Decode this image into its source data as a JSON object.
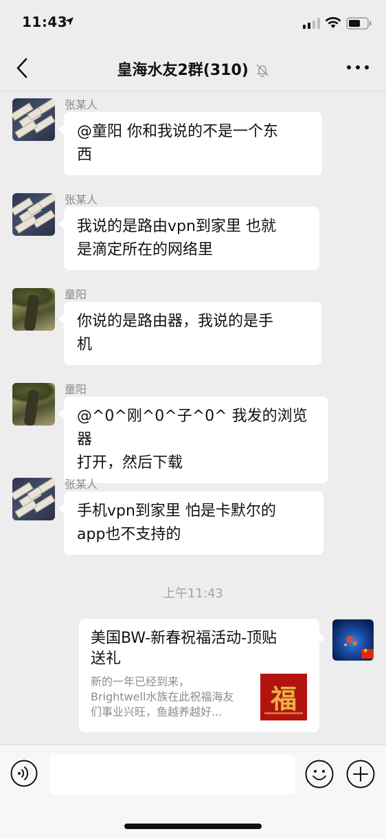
{
  "status_bar": {
    "time": "11:43"
  },
  "nav": {
    "title": "皇海水友2群(310)"
  },
  "messages": [
    {
      "sender": "张某人",
      "text": "@童阳 你和我说的不是一个东西",
      "line1": "@童阳 你和我说的不是一个东",
      "line2": "西"
    },
    {
      "sender": "张某人",
      "text": "我说的是路由vpn到家里 也就是滴定所在的网络里",
      "line1": "我说的是路由vpn到家里 也就",
      "line2": "是滴定所在的网络里"
    },
    {
      "sender": "童阳",
      "text": "你说的是路由器，我说的是手机",
      "line1": "你说的是路由器，我说的是手",
      "line2": "机"
    },
    {
      "sender": "童阳",
      "text": "@^0^刚^0^子^0^ 我发的浏览器打开，然后下载",
      "line1": "@^0^刚^0^子^0^ 我发的浏览器",
      "line2": "打开，然后下载"
    },
    {
      "sender": "张某人",
      "text": "手机vpn到家里  怕是卡默尔的app也不支持的",
      "line1": "手机vpn到家里  怕是卡默尔的",
      "line2": "app也不支持的"
    }
  ],
  "timestamp": "上午11:43",
  "link_card": {
    "title_line1": "美国BW-新春祝福活动-顶贴",
    "title_line2": "送礼",
    "desc": "新的一年已经到来，Brightwell水族在此祝福海友们事业兴旺，鱼越养越好…",
    "desc_line1": "新的一年已经到来，",
    "desc_line2": "Brightwell水族在此祝福海友",
    "desc_line3": "们事业兴旺，鱼越养越好...",
    "thumb_glyph": "福"
  },
  "input": {
    "value": ""
  },
  "icons": {
    "back": "chevron-left-icon",
    "mute": "bell-slash-icon",
    "more": "ellipsis-icon",
    "voice": "voice-icon",
    "emoji": "emoji-icon",
    "plus": "plus-icon"
  },
  "colors": {
    "background": "#ededed",
    "bubble": "#ffffff",
    "secondary_text": "#8a8a8a"
  }
}
